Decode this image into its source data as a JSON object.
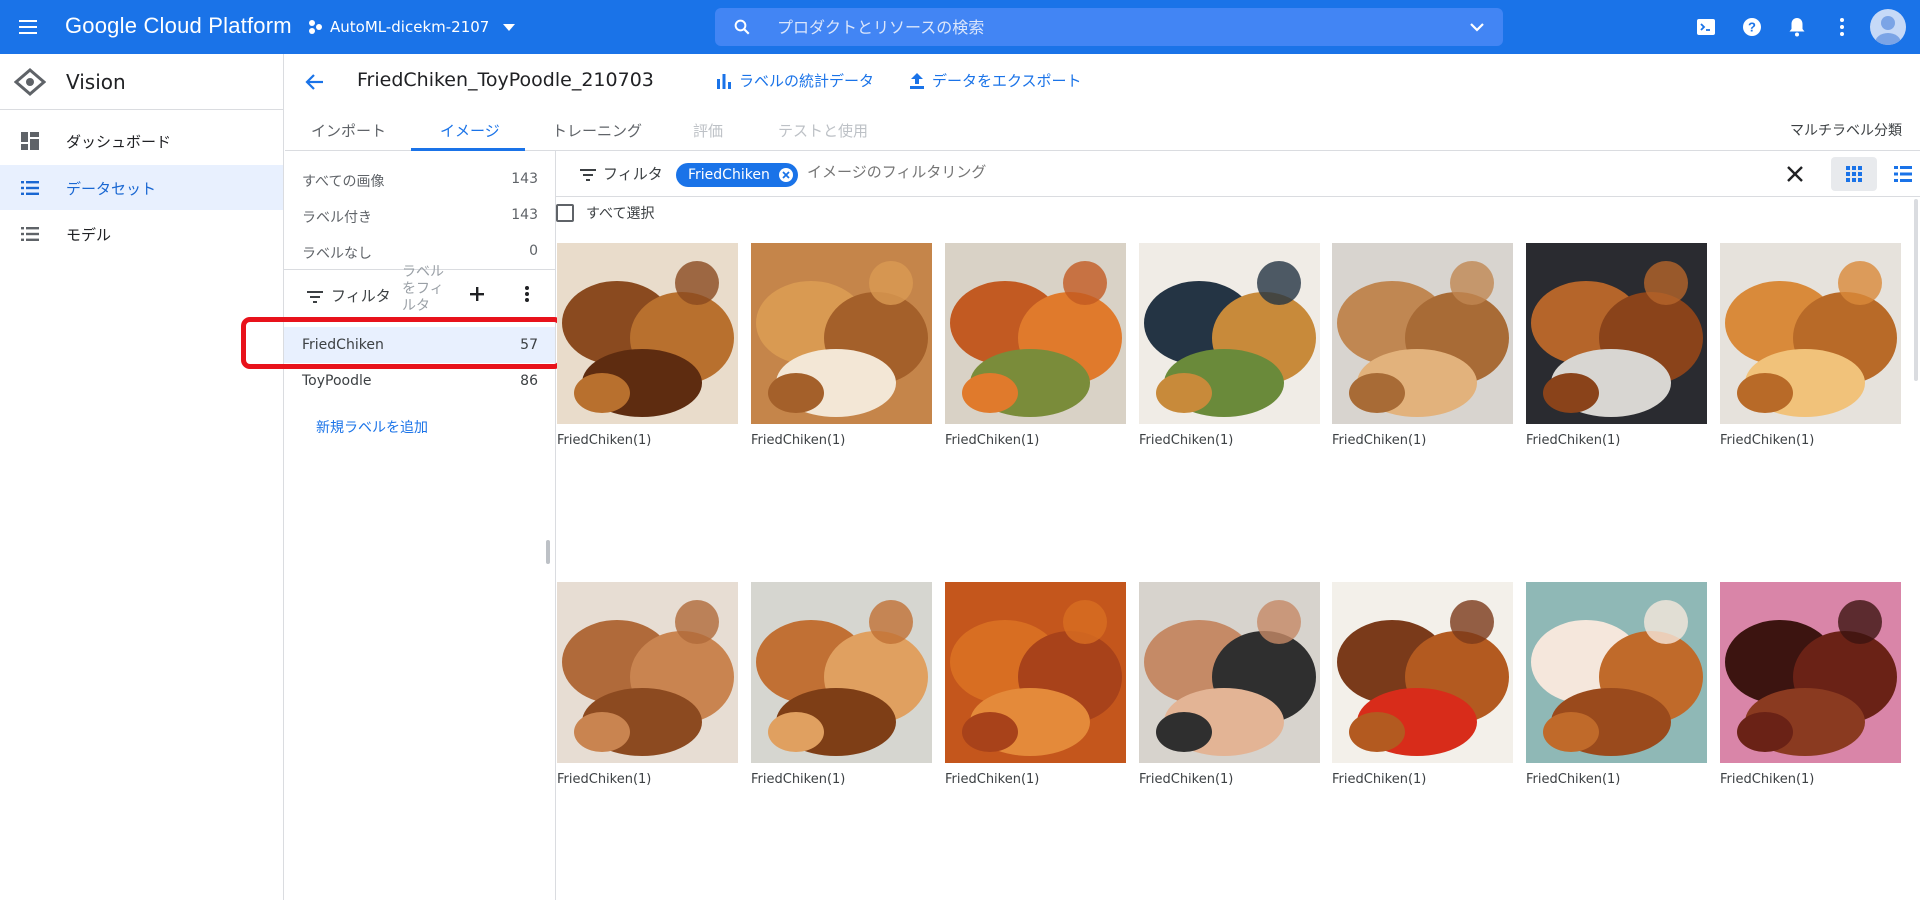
{
  "topbar": {
    "platform_title": "Google Cloud Platform",
    "project_name": "AutoML-dicekm-2107",
    "search_placeholder": "プロダクトとリソースの検索",
    "colors": {
      "bar": "#1a73e8",
      "search_bg": "#4285f4"
    }
  },
  "product": {
    "name": "Vision"
  },
  "nav": {
    "items": [
      {
        "label": "ダッシュボード",
        "icon": "dashboard-icon"
      },
      {
        "label": "データセット",
        "icon": "list-icon",
        "active": true
      },
      {
        "label": "モデル",
        "icon": "list-icon"
      }
    ]
  },
  "header": {
    "dataset_title": "FriedChiken_ToyPoodle_210703",
    "stats_label": "ラベルの統計データ",
    "export_label": "データをエクスポート"
  },
  "tabs": {
    "items": [
      "インポート",
      "イメージ",
      "トレーニング",
      "評価",
      "テストと使用"
    ],
    "active": "イメージ",
    "right_label": "マルチラベル分類"
  },
  "label_panel": {
    "summary": [
      {
        "label": "すべての画像",
        "count": "143"
      },
      {
        "label": "ラベル付き",
        "count": "143"
      },
      {
        "label": "ラベルなし",
        "count": "0"
      }
    ],
    "filter_label": "フィルタ",
    "filter_input_placeholder": "ラベルをフィルタ",
    "labels": [
      {
        "label": "FriedChiken",
        "count": "57",
        "selected": true
      },
      {
        "label": "ToyPoodle",
        "count": "86"
      }
    ],
    "add_label": "新規ラベルを追加"
  },
  "gallery": {
    "filter_label": "フィルタ",
    "chip_label": "FriedChiken",
    "filter_placeholder": "イメージのフィルタリング",
    "select_all": "すべて選択",
    "images": [
      {
        "caption": "FriedChiken(1)"
      },
      {
        "caption": "FriedChiken(1)"
      },
      {
        "caption": "FriedChiken(1)"
      },
      {
        "caption": "FriedChiken(1)"
      },
      {
        "caption": "FriedChiken(1)"
      },
      {
        "caption": "FriedChiken(1)"
      },
      {
        "caption": "FriedChiken(1)"
      },
      {
        "caption": "FriedChiken(1)"
      },
      {
        "caption": "FriedChiken(1)"
      },
      {
        "caption": "FriedChiken(1)"
      },
      {
        "caption": "FriedChiken(1)"
      },
      {
        "caption": "FriedChiken(1)"
      },
      {
        "caption": "FriedChiken(1)"
      },
      {
        "caption": "FriedChiken(1)"
      }
    ],
    "colors": {
      "accent": "#1a73e8",
      "highlight": "#e8121b"
    }
  }
}
